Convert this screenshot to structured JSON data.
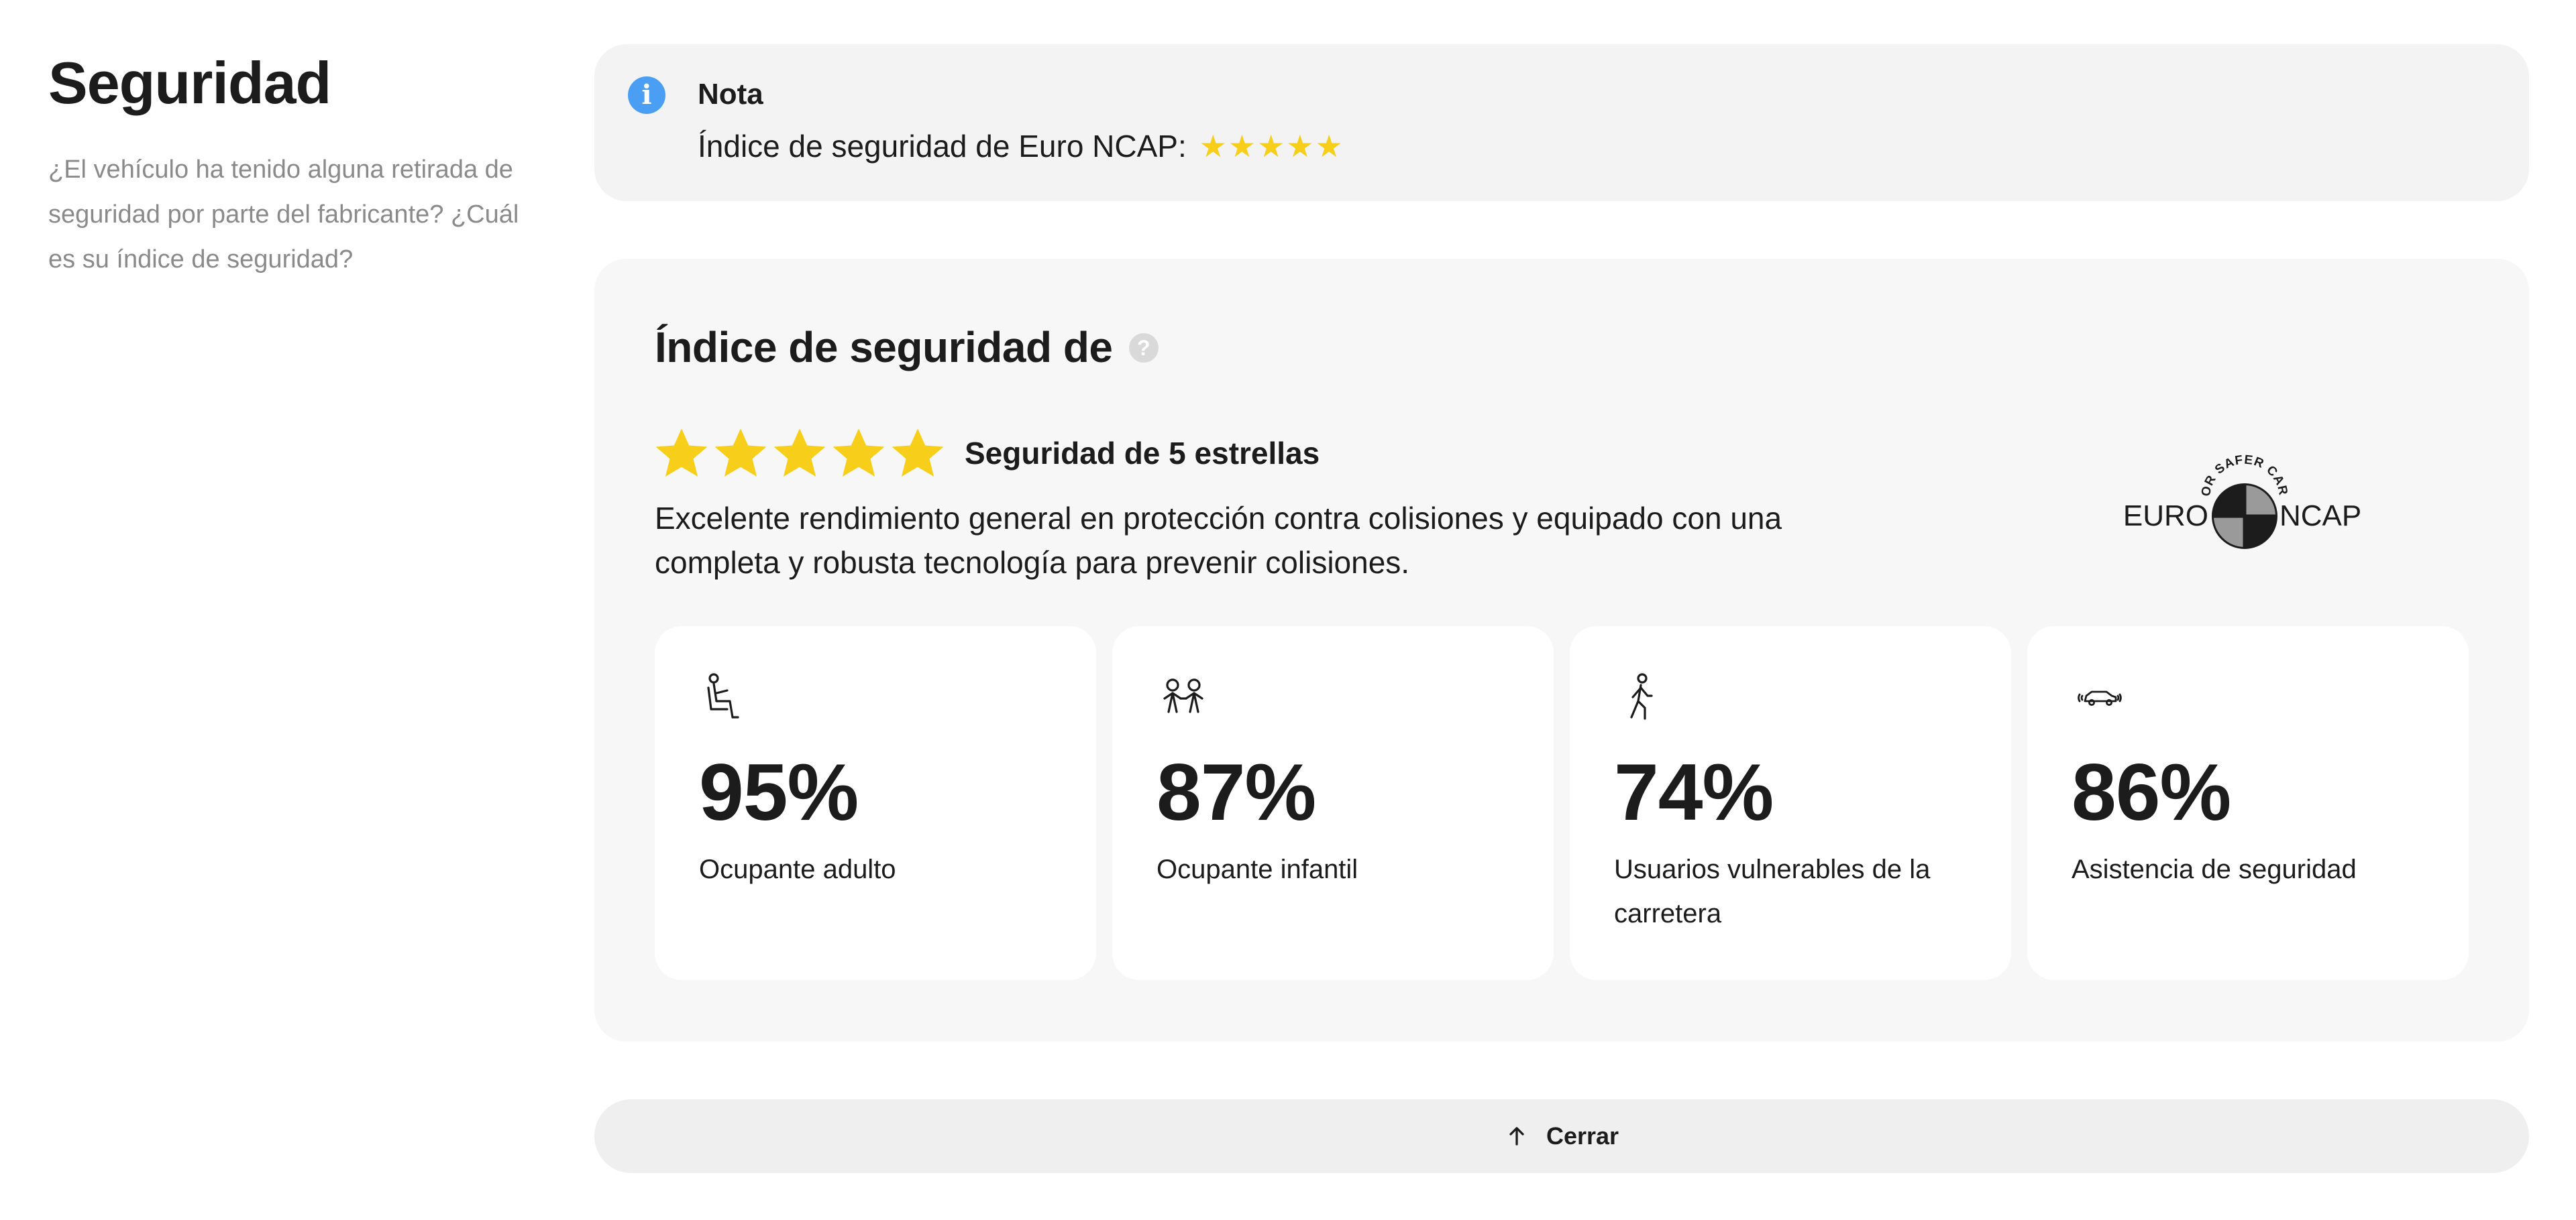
{
  "sidebar": {
    "title": "Seguridad",
    "description": "¿El vehículo ha tenido alguna retirada de seguridad por parte del fabricante? ¿Cuál es su índice de seguridad?"
  },
  "note": {
    "icon": "info-icon",
    "title": "Nota",
    "text": "Índice de seguridad de Euro NCAP:",
    "stars": "★★★★★"
  },
  "rating": {
    "title": "Índice de seguridad de",
    "help_icon": "?",
    "star_count": 5,
    "stars_label": "Seguridad de 5 estrellas",
    "description": "Excelente rendimiento general en protección contra colisiones y equipado con una completa y robusta tecnología para prevenir colisiones.",
    "logo": {
      "top_text": "FOR SAFER CARS",
      "left_text": "EURO",
      "right_text": "NCAP"
    },
    "metrics": [
      {
        "icon": "adult-occupant-icon",
        "value": "95%",
        "label": "Ocupante adulto"
      },
      {
        "icon": "child-occupant-icon",
        "value": "87%",
        "label": "Ocupante infantil"
      },
      {
        "icon": "pedestrian-icon",
        "value": "74%",
        "label": "Usuarios vulnerables de la carretera"
      },
      {
        "icon": "car-sensor-icon",
        "value": "86%",
        "label": "Asistencia de seguridad"
      }
    ]
  },
  "close_button": {
    "label": "Cerrar",
    "icon": "arrow-up-icon"
  },
  "colors": {
    "star": "#f7cf1a",
    "info": "#4a9ff5",
    "card_bg": "#f7f7f7",
    "note_bg": "#f3f3f3"
  }
}
